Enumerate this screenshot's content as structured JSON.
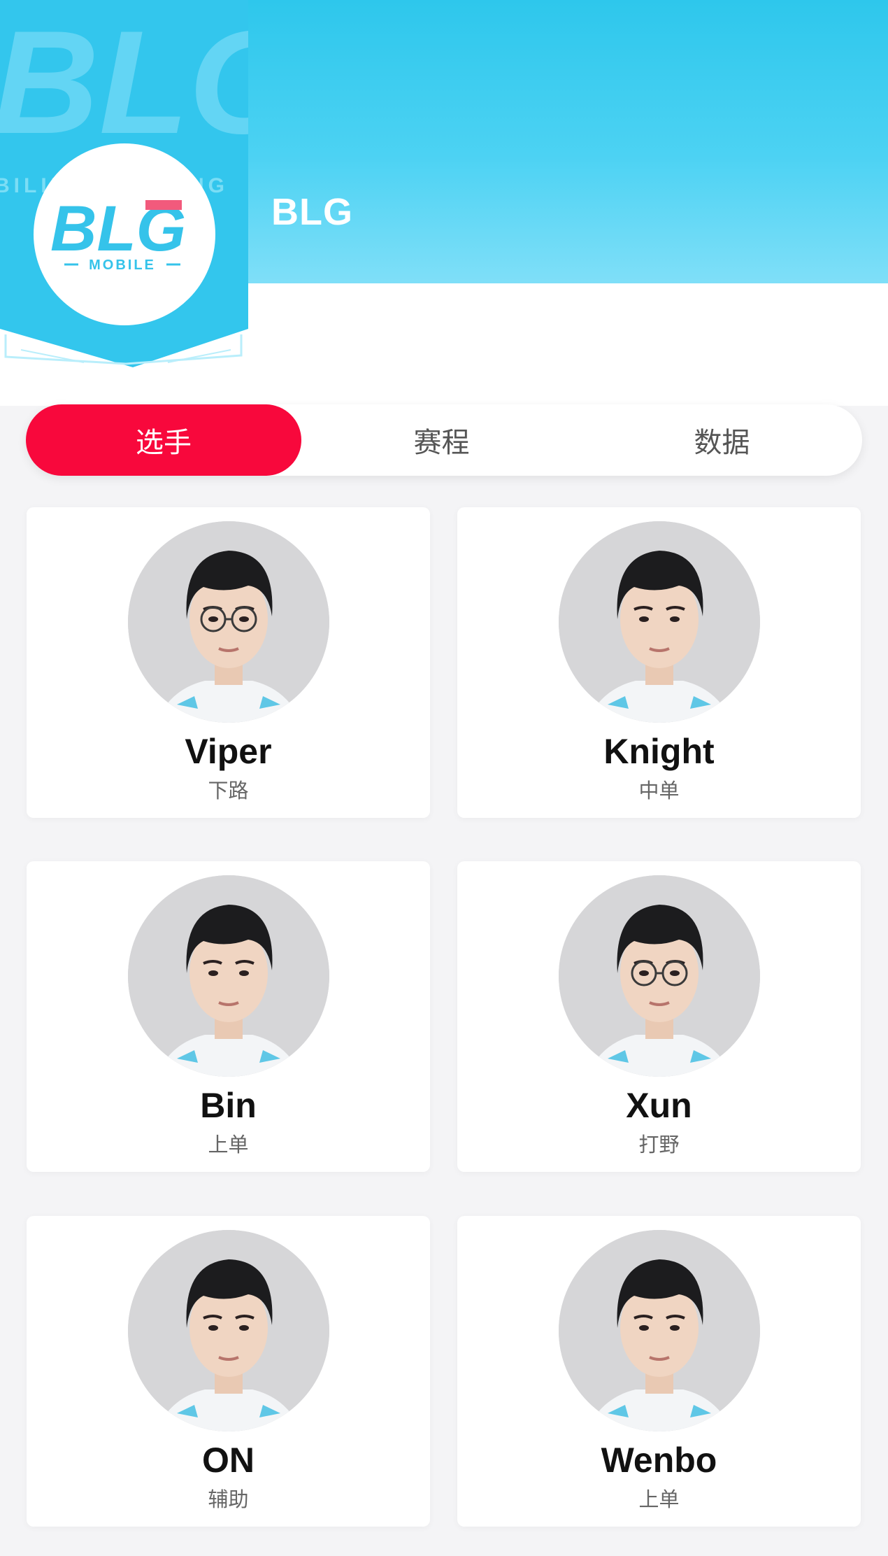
{
  "team": {
    "name": "BLG",
    "logo_text": "BLG",
    "logo_subtext": "MOBILE",
    "banner_text": "BILIBILI GAMING"
  },
  "tabs": [
    {
      "label": "选手",
      "active": true
    },
    {
      "label": "赛程",
      "active": false
    },
    {
      "label": "数据",
      "active": false
    }
  ],
  "players": [
    {
      "name": "Viper",
      "role": "下路",
      "glasses": true
    },
    {
      "name": "Knight",
      "role": "中单",
      "glasses": false
    },
    {
      "name": "Bin",
      "role": "上单",
      "glasses": false
    },
    {
      "name": "Xun",
      "role": "打野",
      "glasses": true
    },
    {
      "name": "ON",
      "role": "辅助",
      "glasses": false
    },
    {
      "name": "Wenbo",
      "role": "上单",
      "glasses": false
    }
  ],
  "colors": {
    "header": "#2ec7ec",
    "accent": "#f8083c",
    "logo_blue": "#35c3ea",
    "logo_pink": "#f25a7c"
  }
}
